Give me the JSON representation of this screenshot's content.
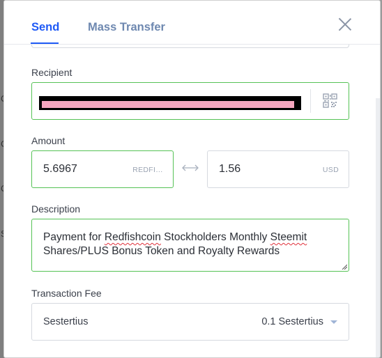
{
  "background": {
    "peek_chars": [
      "C",
      "C",
      "C",
      "S"
    ]
  },
  "tabs": [
    {
      "label": "Send"
    },
    {
      "label": "Mass Transfer"
    }
  ],
  "recipient": {
    "label": "Recipient",
    "value_redacted": true
  },
  "amount": {
    "label": "Amount",
    "value": "5.6967",
    "unit": "REDFI…",
    "converted_value": "1.56",
    "converted_unit": "USD"
  },
  "description": {
    "label": "Description",
    "text_before": "Payment for ",
    "word1": "Redfishcoin",
    "text_mid": " Stockholders Monthly ",
    "word2": "Steemit",
    "text_after": " Shares/PLUS Bonus Token and Royalty Rewards"
  },
  "fee": {
    "label": "Transaction Fee",
    "name": "Sestertius",
    "value": "0.1 Sestertius"
  },
  "colors": {
    "accent": "#1f5af6",
    "valid_border": "#55c255",
    "tab_inactive": "#6e88b0"
  }
}
